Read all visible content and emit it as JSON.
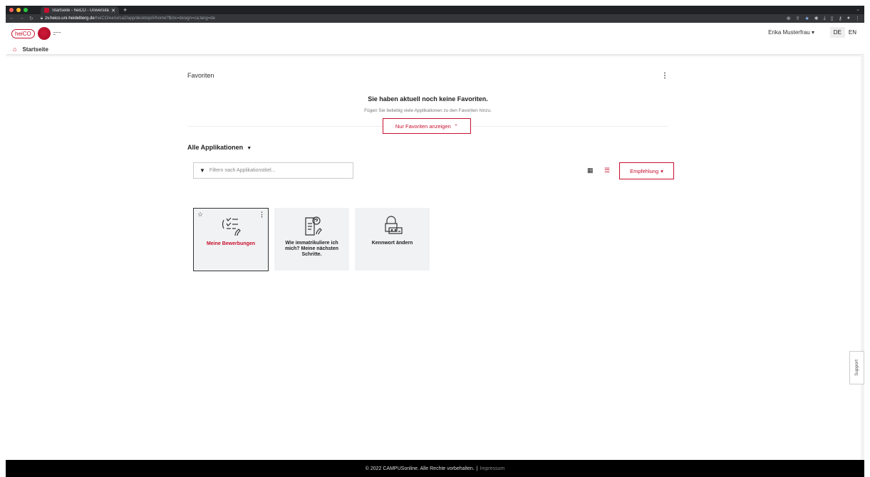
{
  "browser": {
    "tab_title": "Startseite - heiCO - Universitä",
    "url_host": "zv.heico.uni-heidelberg.de",
    "url_path": "/heiCO/ee/ui/ca2/app/desktop/#/home?$ctx=design=ca;lang=de"
  },
  "header": {
    "logo_text": "heiCO",
    "user_name": "Erika Musterfrau",
    "lang_de": "DE",
    "lang_en": "EN"
  },
  "breadcrumb": {
    "label": "Startseite"
  },
  "favorites": {
    "title": "Favoriten",
    "empty_title": "Sie haben aktuell noch keine Favoriten.",
    "empty_sub": "Fügen Sie beliebig viele Applikationen zu den Favoriten hinzu.",
    "toggle_label": "Nur Favoriten anzeigen"
  },
  "apps": {
    "title": "Alle Applikationen",
    "filter_placeholder": "Filtern nach Applikationstitel...",
    "sort_label": "Empfehlung",
    "tiles": [
      {
        "label": "Meine Bewerbungen"
      },
      {
        "label": "Wie immatrikuliere ich mich? Meine nächsten Schritte."
      },
      {
        "label": "Kennwort ändern"
      }
    ]
  },
  "support": {
    "label": "Support"
  },
  "footer": {
    "copyright": "© 2022 CAMPUSonline. Alle Rechte vorbehalten.",
    "separator": "|",
    "impressum": "Impressum"
  },
  "colors": {
    "accent": "#c8102e",
    "footer_bg": "#000000",
    "tile_bg": "#f1f2f3"
  }
}
